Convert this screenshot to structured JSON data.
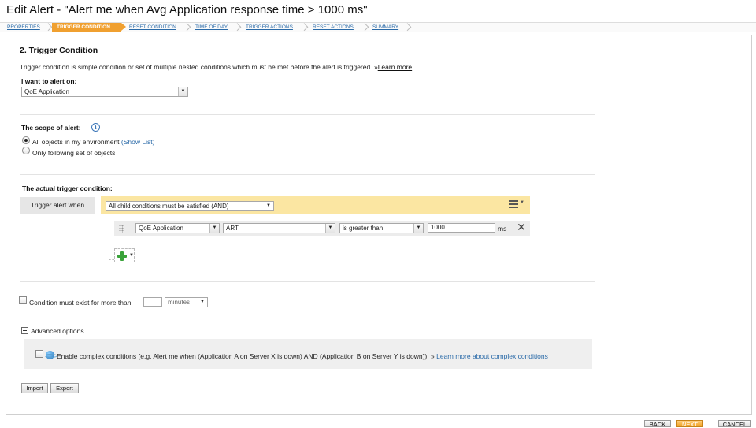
{
  "window": {
    "title": "Edit Alert - \"Alert me when Avg Application response time > 1000 ms\""
  },
  "wizard": {
    "steps": [
      "PROPERTIES",
      "TRIGGER CONDITION",
      "RESET CONDITION",
      "TIME OF DAY",
      "TRIGGER ACTIONS",
      "RESET ACTIONS",
      "SUMMARY"
    ],
    "active_step": "TRIGGER CONDITION"
  },
  "section": {
    "heading": "2. Trigger Condition",
    "description": "Trigger condition is simple condition or set of multiple nested conditions which must be met before the alert is triggered.",
    "learn_more_prefix": "»",
    "learn_more": "Learn more"
  },
  "alert_on": {
    "label": "I want to alert on:",
    "selected": "QoE Application"
  },
  "scope": {
    "label": "The scope of alert:",
    "info_icon": "info-icon",
    "options": [
      {
        "label": "All objects in my environment",
        "link": "(Show List)",
        "checked": true
      },
      {
        "label": "Only following set of objects",
        "checked": false
      }
    ]
  },
  "trigger": {
    "label": "The actual trigger condition:",
    "trigger_label": "Trigger alert when",
    "group_selected": "All child conditions must be satisfied (AND)",
    "condition": {
      "object": "QoE Application",
      "field": "ART",
      "operator": "is greater than",
      "value": "1000",
      "unit": "ms"
    },
    "colors": {
      "group_bar": "#fbe6a2",
      "condition_row": "#ececec",
      "add_icon": "#3aa33a"
    }
  },
  "duration": {
    "label": "Condition must exist for more than",
    "value": "",
    "unit_selected": "minutes"
  },
  "advanced": {
    "label": "Advanced options",
    "complex_label": "Enable complex conditions (e.g. Alert me when (Application A on Server X is down) AND (Application B on Server Y is down)).",
    "complex_prefix": "»",
    "complex_link": "Learn more about complex conditions"
  },
  "buttons": {
    "import": "Import",
    "export": "Export",
    "back": "BACK",
    "next": "NEXT",
    "cancel": "CANCEL"
  },
  "colors": {
    "accent": "#f0a030",
    "link": "#2a6aa8"
  }
}
